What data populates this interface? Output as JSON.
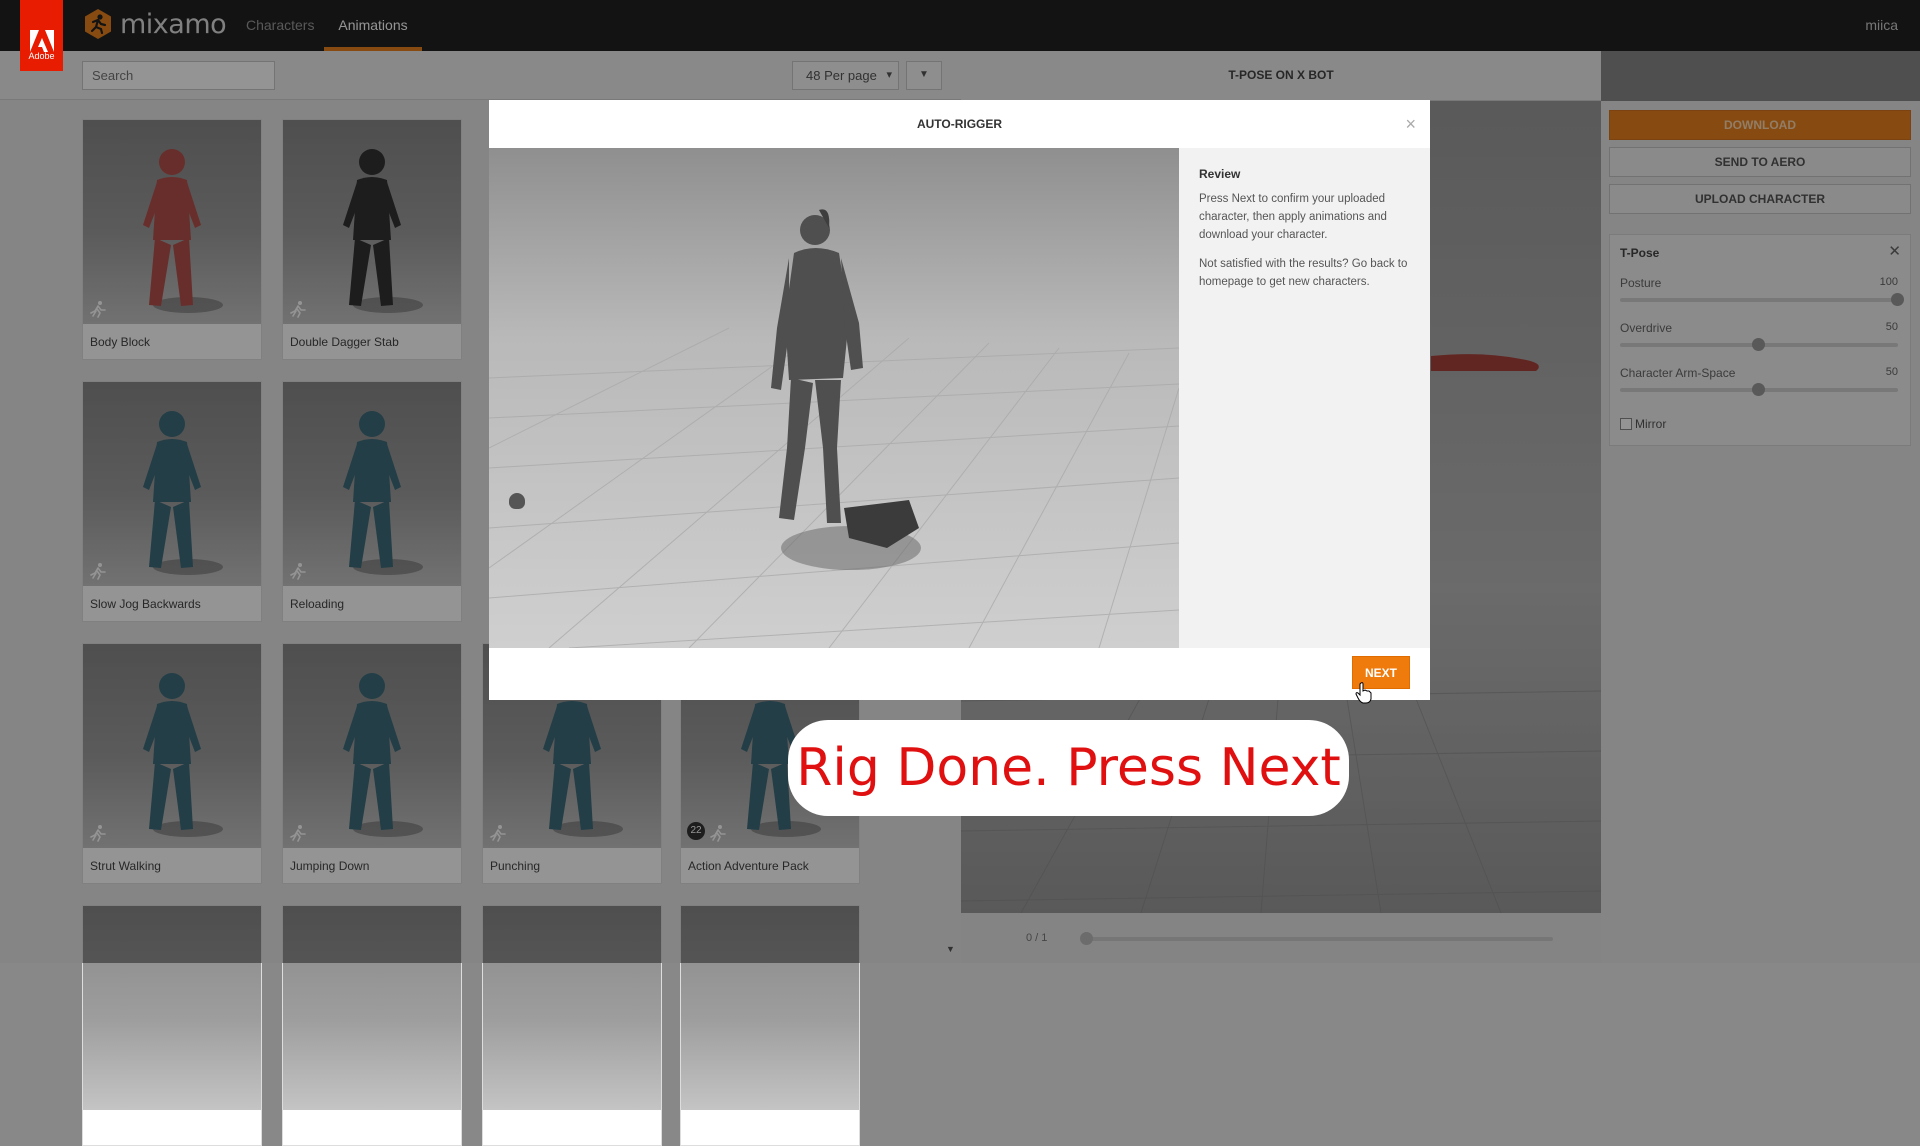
{
  "header": {
    "adobe_label": "Adobe",
    "logo_text": "mixamo",
    "tabs": [
      {
        "label": "Characters",
        "active": false
      },
      {
        "label": "Animations",
        "active": true
      }
    ],
    "user": "miica",
    "accent_color": "#e8821e"
  },
  "toolbar": {
    "search_placeholder": "Search",
    "per_page": "48 Per page"
  },
  "animations": [
    {
      "label": "Body Block",
      "figure_color": "#b4504a"
    },
    {
      "label": "Double Dagger Stab",
      "figure_color": "#333333"
    },
    {
      "label": "Slow Jog Backwards",
      "figure_color": "#3d6b7a"
    },
    {
      "label": "Reloading",
      "figure_color": "#3d6b7a"
    },
    {
      "label": "Strut Walking",
      "figure_color": "#3d6b7a"
    },
    {
      "label": "Jumping Down",
      "figure_color": "#3d6b7a"
    },
    {
      "label": "Punching",
      "figure_color": "#3d6b7a"
    },
    {
      "label": "Action Adventure Pack",
      "figure_color": "#3d6b7a",
      "count": "22"
    }
  ],
  "viewport": {
    "title": "T-POSE ON X BOT",
    "frame_counter": "0 / 1"
  },
  "right_panel": {
    "download": "DOWNLOAD",
    "send_to_aero": "SEND TO AERO",
    "upload_character": "UPLOAD CHARACTER",
    "tpose": {
      "title": "T-Pose",
      "sliders": [
        {
          "name": "Posture",
          "value": "100",
          "fraction": 1.0
        },
        {
          "name": "Overdrive",
          "value": "50",
          "fraction": 0.5
        },
        {
          "name": "Character Arm-Space",
          "value": "50",
          "fraction": 0.5
        }
      ],
      "mirror": "Mirror"
    }
  },
  "modal": {
    "title": "AUTO-RIGGER",
    "close": "×",
    "review_heading": "Review",
    "review_p1": "Press Next to confirm your uploaded character, then apply animations and download your character.",
    "review_p2": "Not satisfied with the results? Go back to homepage to get new characters.",
    "next": "NEXT"
  },
  "caption": "Rig Done. Press Next"
}
